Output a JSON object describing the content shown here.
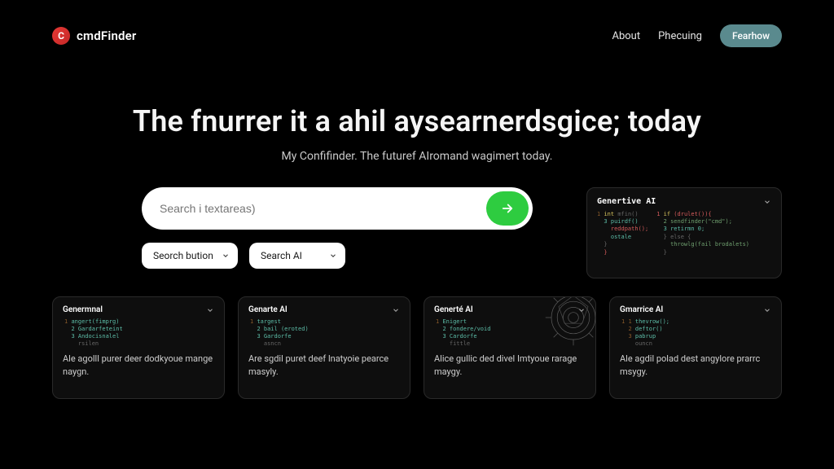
{
  "brand": {
    "name": "cmdFinder",
    "mark": "C"
  },
  "nav": {
    "about": "About",
    "pricing": "Phecuing",
    "cta": "Fearhow"
  },
  "hero": {
    "title": "The fnurrer it a ahil aysearnerdsgice; today",
    "subtitle": "My Confifinder. The futuref AIromand wagimert today."
  },
  "search": {
    "placeholder": "Search i textareas)",
    "filter1": "Seorch bution",
    "filter2": "Search AI"
  },
  "side_panel": {
    "title": "Genertive AI"
  },
  "cards": [
    {
      "title": "Genermnal",
      "desc": "Ale agolll purer deer dodkyoue mange naygn."
    },
    {
      "title": "Genarte AI",
      "desc": "Are sgdil puret deef lnatyoie pearce masyly."
    },
    {
      "title": "Generté AI",
      "desc": "Alice gullic ded divel Imtyoue rarage maygy."
    },
    {
      "title": "Gmarrice AI",
      "desc": "Ale agdil polad dest angylore prarrc msygy."
    }
  ]
}
